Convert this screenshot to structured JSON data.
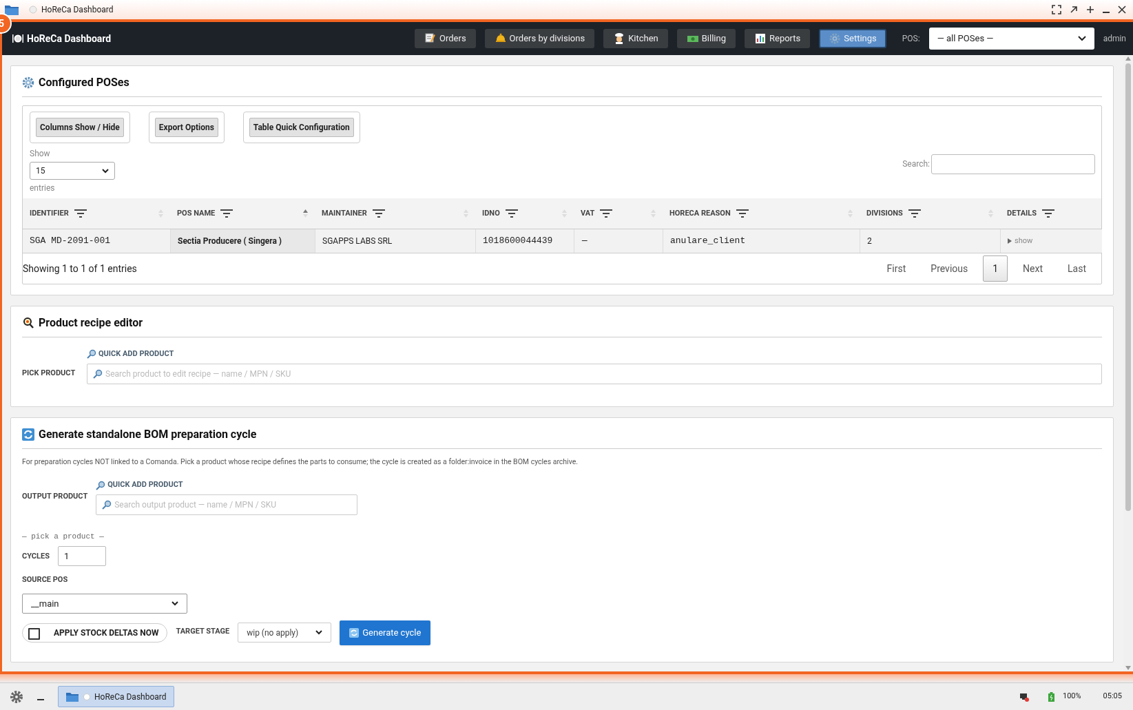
{
  "window": {
    "title": "HoReCa Dashboard",
    "badge": "5"
  },
  "navbar": {
    "brand": "HoReCa Dashboard",
    "items": [
      {
        "label": "Orders",
        "selected": false
      },
      {
        "label": "Orders by divisions",
        "selected": false
      },
      {
        "label": "Kitchen",
        "selected": false
      },
      {
        "label": "Billing",
        "selected": false
      },
      {
        "label": "Reports",
        "selected": false
      },
      {
        "label": "Settings",
        "selected": true
      }
    ],
    "pos_label": "POS:",
    "pos_value": "— all POSes —",
    "user": "admin"
  },
  "pos_panel": {
    "title": "Configured POSes",
    "tools": [
      "Columns Show / Hide",
      "Export Options",
      "Table Quick Configuration"
    ],
    "show_label": "Show",
    "page_size": "15",
    "entries_label": "entries",
    "search_label": "Search:",
    "columns": [
      {
        "label": "IDENTIFIER",
        "sortable": true,
        "sorted": false
      },
      {
        "label": "POS NAME",
        "sortable": true,
        "sorted": true
      },
      {
        "label": "MAINTAINER",
        "sortable": true,
        "sorted": false
      },
      {
        "label": "IDNO",
        "sortable": true,
        "sorted": false
      },
      {
        "label": "VAT",
        "sortable": true,
        "sorted": false
      },
      {
        "label": "HORECA REASON",
        "sortable": true,
        "sorted": false
      },
      {
        "label": "DIVISIONS",
        "sortable": true,
        "sorted": false
      },
      {
        "label": "DETAILS",
        "sortable": false,
        "sorted": false
      }
    ],
    "rows": [
      {
        "cells": [
          "SGA MD-2091-001",
          "Sectia Producere ( Singera )",
          "SGAPPS LABS SRL",
          "1018600044439",
          "—",
          "anulare_client",
          "2",
          "show"
        ]
      }
    ],
    "info": "Showing 1 to 1 of 1 entries",
    "pages": [
      {
        "label": "First",
        "selected": false
      },
      {
        "label": "Previous",
        "selected": false
      },
      {
        "label": "1",
        "selected": true
      },
      {
        "label": "Next",
        "selected": false
      },
      {
        "label": "Last",
        "selected": false
      }
    ]
  },
  "recipe_panel": {
    "title": "Product recipe editor",
    "quick_add": "QUICK ADD PRODUCT",
    "label": "PICK PRODUCT",
    "placeholder": "Search product to edit recipe — name / MPN / SKU"
  },
  "bom_panel": {
    "title": "Generate standalone BOM preparation cycle",
    "description": "For preparation cycles NOT linked to a Comanda. Pick a product whose recipe defines the parts to consume; the cycle is created as a folder:invoice in the BOM cycles archive.",
    "quick_add": "QUICK ADD PRODUCT",
    "output_label": "OUTPUT PRODUCT",
    "output_placeholder": "Search output product — name / MPN / SKU",
    "pick_hint": "— pick a product —",
    "cycles_label": "CYCLES",
    "cycles_value": "1",
    "source_label": "SOURCE POS",
    "source_value": "__main",
    "apply_label": "APPLY STOCK DELTAS NOW",
    "apply_checked": false,
    "stage_label": "TARGET STAGE",
    "stage_value": "wip (no apply)",
    "generate": "Generate cycle"
  },
  "taskbar": {
    "task": "HoReCa Dashboard",
    "battery": "100%",
    "clock": "05:05"
  }
}
